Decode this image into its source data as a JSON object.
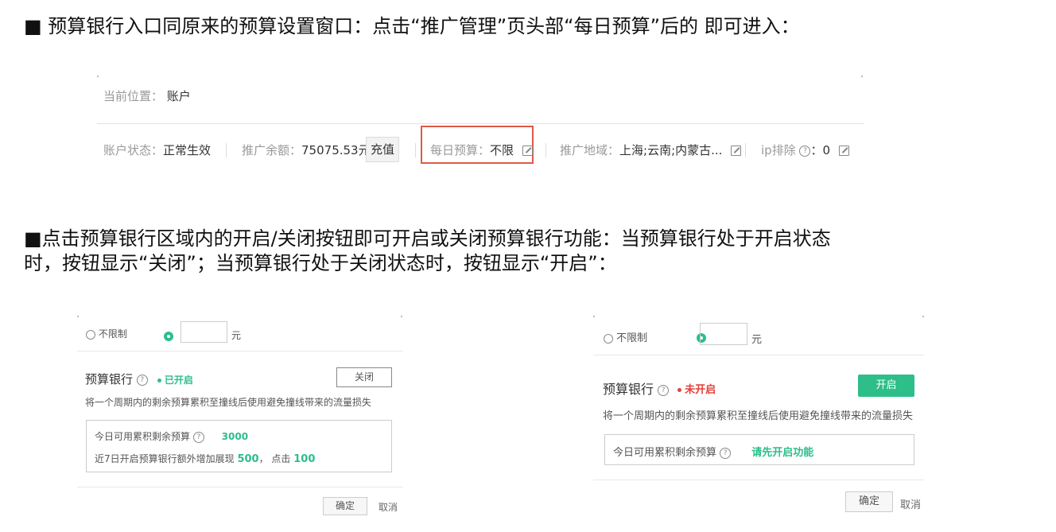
{
  "paragraphs": {
    "p1": "■ 预算银行入口同原来的预算设置窗口：点击“推广管理”页头部“每日预算”后的 即可进入：",
    "p2_line1": "■点击预算银行区域内的开启/关闭按钮即可开启或关闭预算银行功能：当预算银行处于开启状态",
    "p2_line2": "时，按钮显示“关闭”；当预算银行处于关闭状态时，按钮显示“开启”："
  },
  "account_bar": {
    "location_label": "当前位置：",
    "location_value": "账户",
    "status_label": "账户状态：",
    "status_value": "正常生效",
    "balance_label": "推广余额：",
    "balance_value": "75075.53元",
    "recharge_button": "充值",
    "budget_label": "每日预算：",
    "budget_value": "不限",
    "region_label": "推广地域：",
    "region_value": "上海;云南;内蒙古...",
    "ip_label": "ip排除",
    "ip_value": "：0",
    "highlight_color": "#e05a45"
  },
  "panel_left": {
    "radio_unlimited": "不限制",
    "unit": "元",
    "title": "预算银行",
    "status": "已开启",
    "toggle_button": "关闭",
    "description": "将一个周期内的剩余预算累积至撞线后使用避免撞线带来的流量损失",
    "today_label": "今日可用累积剩余预算",
    "today_value": "3000",
    "week_label": "近7日开启预算银行额外增加展现",
    "week_value": "500",
    "week_mid": "，  点击",
    "week_click": "100",
    "confirm": "确定",
    "cancel": "取消"
  },
  "panel_right": {
    "radio_unlimited": "不限制",
    "unit": "元",
    "title": "预算银行",
    "status": "未开启",
    "toggle_button": "开启",
    "description": "将一个周期内的剩余预算累积至撞线后使用避免撞线带来的流量损失",
    "today_label": "今日可用累积剩余预算",
    "today_value": "请先开启功能",
    "confirm": "确定",
    "cancel": "取消"
  },
  "colors": {
    "green": "#2dbe8a",
    "red": "#e0403a"
  }
}
